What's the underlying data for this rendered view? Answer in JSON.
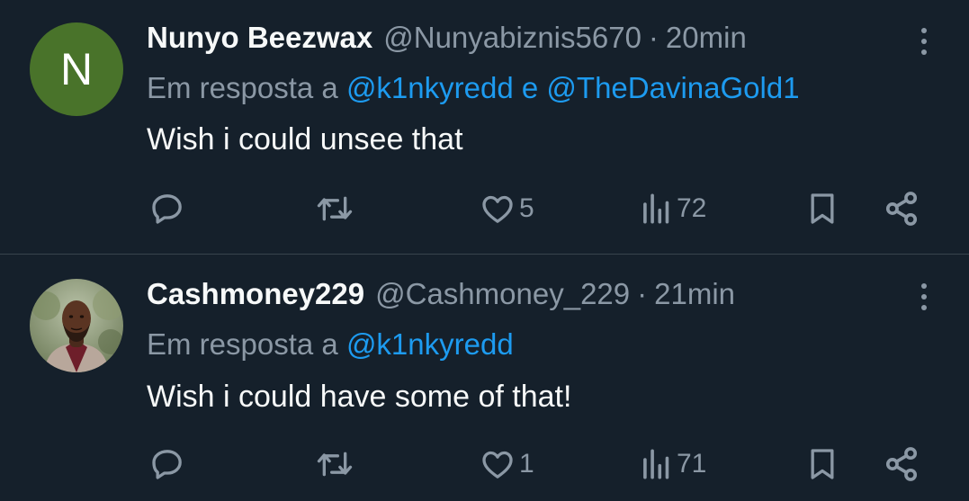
{
  "tweets": [
    {
      "avatar_letter": "N",
      "avatar_color": "#49732a",
      "name": "Nunyo Beezwax",
      "handle": "@Nunyabiznis5670",
      "separator": "·",
      "time": "20min",
      "reply_prefix": "Em resposta a ",
      "mention1": "@k1nkyredd",
      "conjunction": " e ",
      "mention2": "@TheDavinaGold1",
      "text": "Wish i could unsee that",
      "likes": "5",
      "views": "72"
    },
    {
      "name": "Cashmoney229",
      "handle": "@Cashmoney_229",
      "separator": "·",
      "time": "21min",
      "reply_prefix": "Em resposta a ",
      "mention1": "@k1nkyredd",
      "text": "Wish i could have some of that!",
      "likes": "1",
      "views": "71"
    }
  ],
  "icons": {
    "reply": "reply-icon",
    "retweet": "retweet-icon",
    "like": "heart-icon",
    "views": "views-icon",
    "bookmark": "bookmark-icon",
    "share": "share-icon",
    "more": "more-icon"
  },
  "colors": {
    "background": "#15202b",
    "text": "#f7f9f9",
    "secondary": "#8b98a5",
    "link": "#1d9bf0",
    "divider": "#38444d"
  }
}
